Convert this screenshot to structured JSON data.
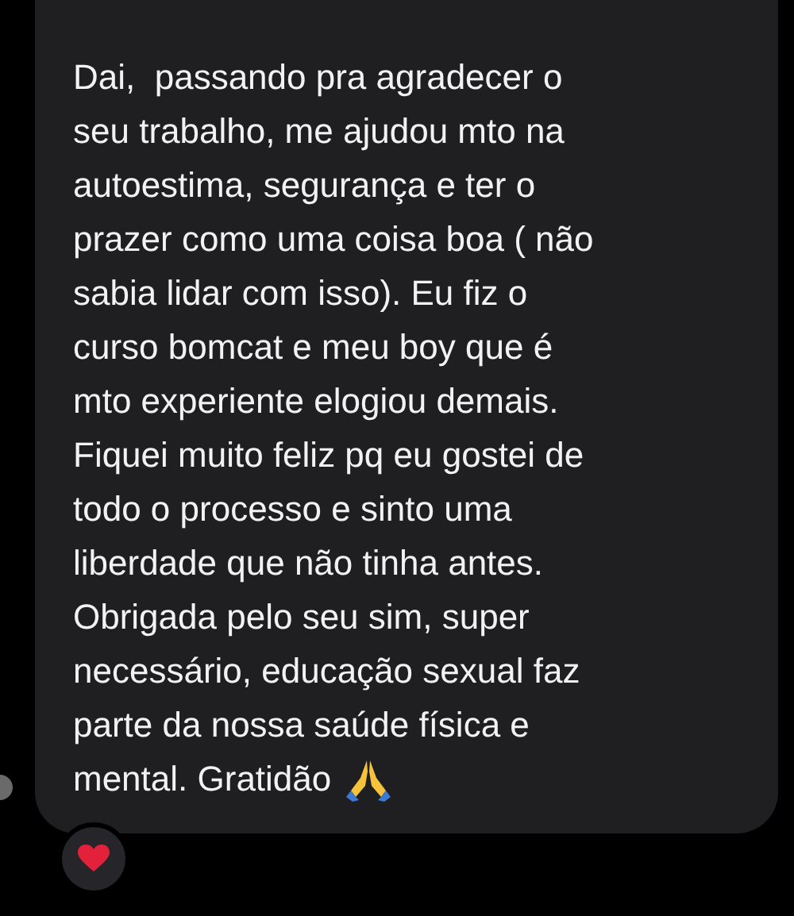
{
  "message": {
    "text": "Dai,  passando pra agradecer o\nseu trabalho, me ajudou mto na\nautoestima, segurança e ter o\nprazer como uma coisa boa ( não\nsabia lidar com isso). Eu fiz o\ncurso bomcat e meu boy que é\nmto experiente elogiou demais.\nFiquei muito feliz pq eu gostei de\ntodo o processo e sinto uma\nliberdade que não tinha antes.\nObrigada pelo seu sim, super\nnecessário, educação sexual faz\nparte da nossa saúde física e",
    "closing": "mental. Gratidão"
  },
  "reaction": {
    "kind": "heart"
  }
}
